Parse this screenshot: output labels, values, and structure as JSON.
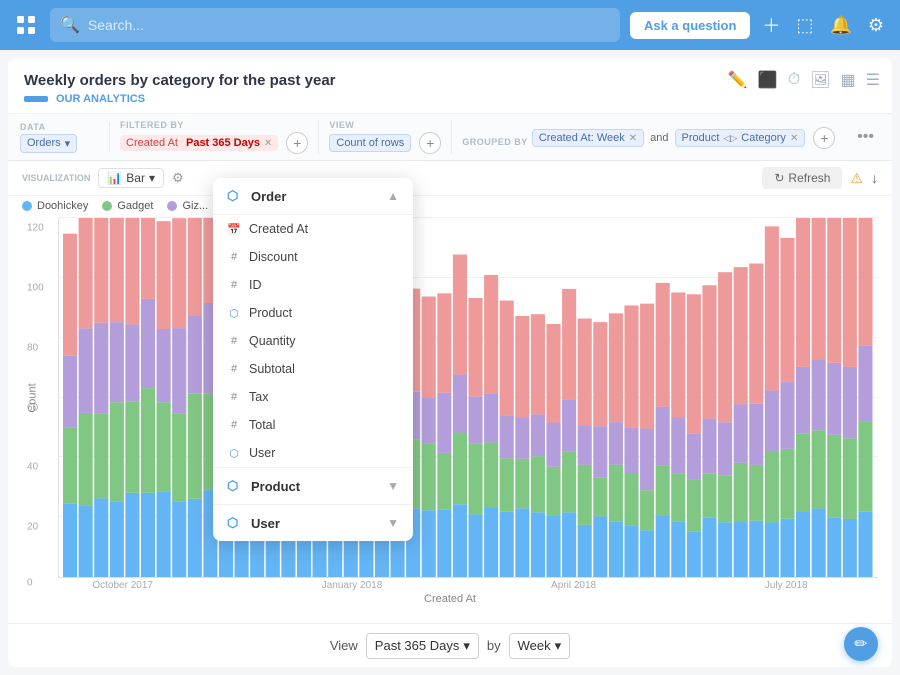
{
  "topbar": {
    "search_placeholder": "Search...",
    "ask_button": "Ask a question"
  },
  "page": {
    "title": "Weekly orders by category for the past year",
    "subtitle": "OUR ANALYTICS"
  },
  "query_bar": {
    "data_label": "DATA",
    "data_value": "Orders",
    "filtered_label": "FILTERED BY",
    "filtered_chip": "Created At",
    "filtered_date": "Past 365 Days",
    "view_label": "VIEW",
    "view_value": "Count of rows",
    "grouped_label": "GROUPED BY",
    "grouped_week": "Created At: Week",
    "grouped_and": "and",
    "grouped_product": "Product",
    "grouped_category": "Category"
  },
  "viz": {
    "label": "VISUALIZATION",
    "type": "Bar",
    "refresh": "Refresh"
  },
  "legend": [
    {
      "label": "Doohickey",
      "color": "#64b5f6"
    },
    {
      "label": "Gadget",
      "color": "#81c784"
    },
    {
      "label": "Giz...",
      "color": "#b39ddb"
    }
  ],
  "chart": {
    "y_axis_label": "Count",
    "x_axis_label": "Created At",
    "y_ticks": [
      "0",
      "20",
      "40",
      "60",
      "80",
      "100",
      "120"
    ],
    "x_labels": [
      "October 2017",
      "January 2018",
      "April 2018",
      "July 2018"
    ],
    "colors": {
      "blue": "#64b5f6",
      "green": "#81c784",
      "purple": "#b39ddb",
      "pink": "#ef9a9a"
    }
  },
  "dropdown": {
    "order_section": "Order",
    "items": [
      {
        "label": "Created At",
        "icon": "calendar"
      },
      {
        "label": "Discount",
        "icon": "hash"
      },
      {
        "label": "ID",
        "icon": "hash"
      },
      {
        "label": "Product",
        "icon": "link"
      },
      {
        "label": "Quantity",
        "icon": "hash"
      },
      {
        "label": "Subtotal",
        "icon": "hash"
      },
      {
        "label": "Tax",
        "icon": "hash"
      },
      {
        "label": "Total",
        "icon": "hash"
      },
      {
        "label": "User",
        "icon": "link"
      }
    ],
    "product_section": "Product",
    "user_section": "User"
  },
  "bottom_bar": {
    "view_label": "View",
    "period": "Past 365 Days",
    "by_label": "by",
    "interval": "Week"
  }
}
